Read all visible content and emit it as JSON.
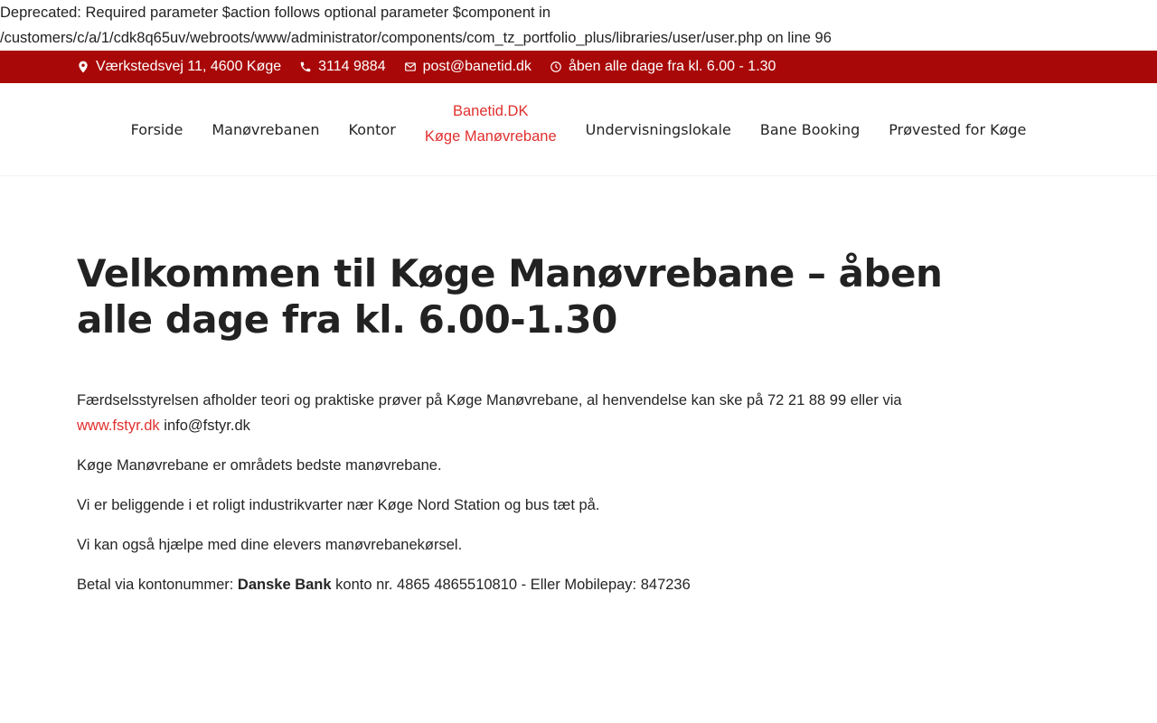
{
  "deprecated": {
    "line1": "Deprecated: Required parameter $action follows optional parameter $component in",
    "line2": "/customers/c/a/1/cdk8q65uv/webroots/www/administrator/components/com_tz_portfolio_plus/libraries/user/user.php on line 96"
  },
  "topbar": {
    "address": "Værkstedsvej 11, 4600 Køge",
    "phone": "3114 9884",
    "email": "post@banetid.dk",
    "hours": "åben alle dage fra kl. 6.00 - 1.30",
    "icons": [
      "map-pin-icon",
      "phone-icon",
      "envelope-icon",
      "clock-icon"
    ]
  },
  "nav": {
    "items_left": [
      "Forside",
      "Manøvrebanen",
      "Kontor"
    ],
    "logo_line1": "Banetid.DK",
    "logo_line2": "Køge Manøvrebane",
    "items_right": [
      "Undervisningslokale",
      "Bane Booking",
      "Prøvested for Køge"
    ]
  },
  "main": {
    "title": "Velkommen til Køge Manøvrebane – åben alle dage fra kl. 6.00-1.30",
    "p1_text": "Færdselsstyrelsen afholder teori og praktiske prøver på Køge Manøvrebane, al henvendelse kan ske på 72 21 88 99 eller via",
    "p1_link": "www.fstyr.dk",
    "p1_after": " info@fstyr.dk",
    "p2": "Køge Manøvrebane er områdets bedste manøvrebane.",
    "p3": "Vi er beliggende i et roligt industrikvarter nær Køge Nord Station og bus tæt på.",
    "p4": "Vi kan også hjælpe med dine elevers manøvrebanekørsel.",
    "p5_before": "Betal via kontonummer: ",
    "p5_bold": "Danske Bank",
    "p5_after": " konto nr. 4865 4865510810 - Eller Mobilepay: 847236"
  },
  "colors": {
    "topbar_bg": "#a90808",
    "accent": "#e0302e"
  }
}
